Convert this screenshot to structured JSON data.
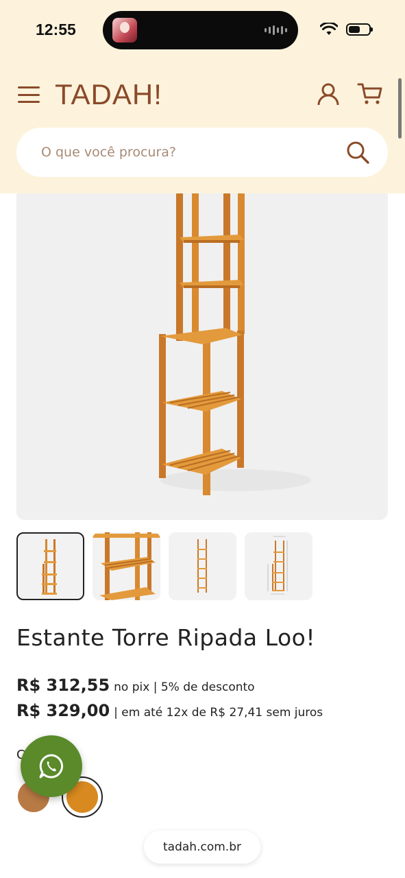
{
  "status_bar": {
    "time": "12:55"
  },
  "header": {
    "logo": "TADAH!"
  },
  "search": {
    "placeholder": "O que você procura?"
  },
  "product": {
    "title": "Estante Torre Ripada Loo!",
    "pix_price": "R$ 312,55",
    "pix_note": "no pix | 5% de desconto",
    "card_price": "R$ 329,00",
    "card_note": "| em até 12x de R$ 27,41 sem juros",
    "color_label": "C",
    "swatches": [
      {
        "color": "#b87a44"
      },
      {
        "color": "#d8891f",
        "selected": true
      }
    ]
  },
  "colors": {
    "header_bg": "#fdf3dc",
    "brand": "#8a4a2a",
    "whatsapp": "#5a8a2a",
    "wood": "#d5862e"
  },
  "thumbnails": [
    {
      "icon": "shelf-full-view",
      "selected": true
    },
    {
      "icon": "shelf-detail-view"
    },
    {
      "icon": "shelf-front-view"
    },
    {
      "icon": "shelf-dimensions-view"
    }
  ],
  "browser": {
    "url": "tadah.com.br"
  }
}
